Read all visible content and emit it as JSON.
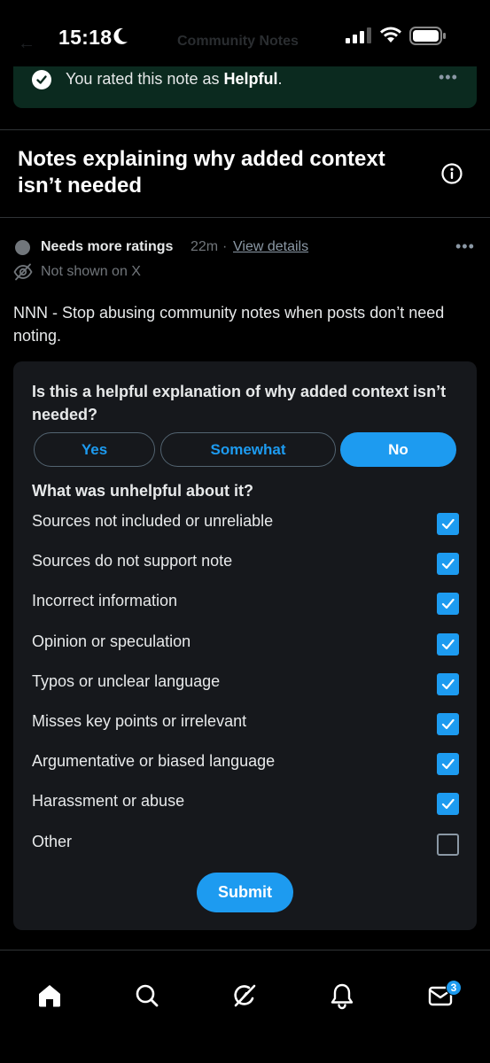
{
  "status_bar": {
    "time": "15:18",
    "ghost_title": "Community Notes"
  },
  "rated_banner": {
    "prefix": "You rated this note as ",
    "rating": "Helpful",
    "suffix": ".",
    "more": "•••"
  },
  "section": {
    "title": "Notes explaining why added context isn’t needed"
  },
  "note": {
    "status": "Needs more ratings",
    "time": "22m",
    "separator": "·",
    "details_link": "View details",
    "visibility": "Not shown on X",
    "more": "•••",
    "body": "NNN - Stop abusing community notes when posts don’t need noting."
  },
  "rating_card": {
    "question": "Is this a helpful explanation of why added context isn’t needed?",
    "options": [
      "Yes",
      "Somewhat",
      "No"
    ],
    "selected_option": "No",
    "reasons_title": "What was unhelpful about it?",
    "reasons": [
      {
        "label": "Sources not included or unreliable",
        "checked": true
      },
      {
        "label": "Sources do not support note",
        "checked": true
      },
      {
        "label": "Incorrect information",
        "checked": true
      },
      {
        "label": "Opinion or speculation",
        "checked": true
      },
      {
        "label": "Typos or unclear language",
        "checked": true
      },
      {
        "label": "Misses key points or irrelevant",
        "checked": true
      },
      {
        "label": "Argumentative or biased language",
        "checked": true
      },
      {
        "label": "Harassment or abuse",
        "checked": true
      },
      {
        "label": "Other",
        "checked": false
      }
    ],
    "submit_label": "Submit"
  },
  "tabbar": {
    "items": [
      "home-icon",
      "search-icon",
      "grok-icon",
      "notifications-icon",
      "messages-icon"
    ],
    "messages_badge": "3"
  },
  "colors": {
    "accent": "#1d9bf0",
    "banner": "#0b2a1f",
    "card": "#16181c",
    "background": "#000000"
  }
}
